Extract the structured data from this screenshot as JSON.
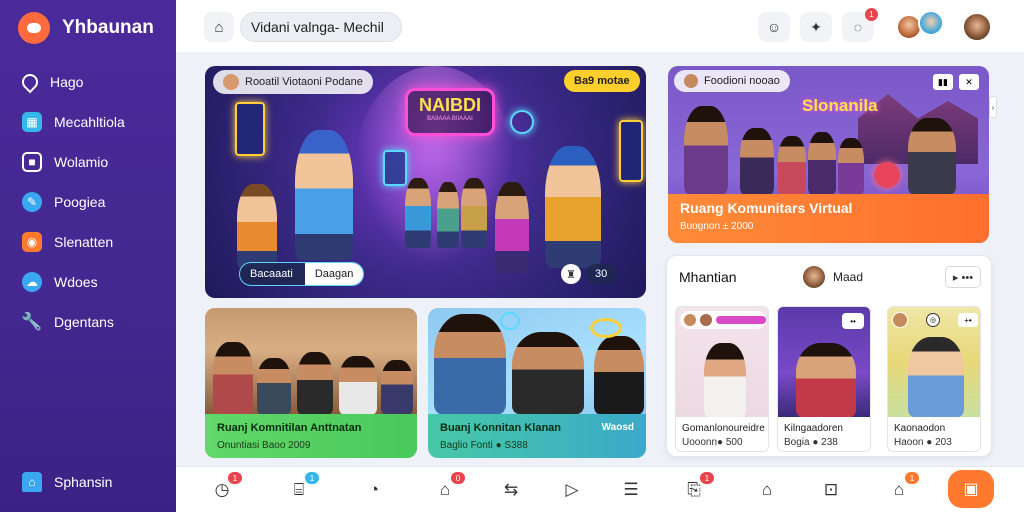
{
  "brand": {
    "name": "Yhbaunan"
  },
  "sidebar": {
    "items": [
      {
        "label": "Hago",
        "icon": "location-pin-icon",
        "color": "#3a2284"
      },
      {
        "label": "Mecahltiola",
        "icon": "grid-icon",
        "color": "#35b8e8"
      },
      {
        "label": "Wolamio",
        "icon": "lock-icon",
        "color": "#3a2284"
      },
      {
        "label": "Poogiea",
        "icon": "chat-bubble-icon",
        "color": "#3aa8f0"
      },
      {
        "label": "Slenatten",
        "icon": "calendar-icon",
        "color": "#ff7a2e"
      },
      {
        "label": "Wdoes",
        "icon": "cloud-icon",
        "color": "#3aa8f0"
      },
      {
        "label": "Dgentans",
        "icon": "wrench-icon",
        "color": "#ff9a3d"
      }
    ],
    "bottom": {
      "label": "Sphansin",
      "icon": "home-icon",
      "color": "#3aa8f0"
    }
  },
  "topbar": {
    "search_value": "Vidani valnga- Mechil",
    "notification_count": "1"
  },
  "hero": {
    "tag": "Rooatil Viotaoni Podane",
    "badge": "Ba9 motae",
    "sign_title": "NAIBDI",
    "sign_sub": "BAIIAAA BIIAAAI",
    "cta_left": "Bacaaati",
    "cta_right": "Daagan",
    "counter": "30"
  },
  "right_top": {
    "tag": "Foodioni nooao",
    "sign": "Slonanila",
    "title": "Ruang Komunitars Virtual",
    "sub": "Buognon ± 2000"
  },
  "bottom_left": {
    "title": "Ruanj Komnitilan Anttnatan",
    "sub": "Onuntiasi Baoo 2009"
  },
  "bottom_mid": {
    "title": "Buanj Konnitan Klanan",
    "sub": "Baglio Fonti ● S388",
    "tag": "Waosd"
  },
  "panel": {
    "title": "Mhantian",
    "user": "Maad",
    "more": "▸ •••",
    "cards": [
      {
        "title": "Gomanlonoureidre",
        "sub": "Uooonn● 500"
      },
      {
        "title": "Kilngaadoren",
        "sub": "Bogia ● 238"
      },
      {
        "title": "Kaonaodon",
        "sub": "Haoon ● 203"
      }
    ]
  },
  "bottomnav": {
    "items": [
      {
        "icon": "clock-icon",
        "badge": "1"
      },
      {
        "icon": "bookmark-icon",
        "badge": "1"
      },
      {
        "icon": "chat-icon",
        "badge": ""
      },
      {
        "icon": "home-icon",
        "badge": "0"
      },
      {
        "icon": "shuffle-icon",
        "badge": ""
      },
      {
        "icon": "play-icon",
        "badge": ""
      },
      {
        "icon": "menu-icon",
        "badge": ""
      },
      {
        "icon": "calendar-icon",
        "badge": "1"
      },
      {
        "icon": "tag-icon",
        "badge": ""
      },
      {
        "icon": "inbox-icon",
        "badge": ""
      },
      {
        "icon": "house-icon",
        "badge": "1"
      }
    ]
  }
}
